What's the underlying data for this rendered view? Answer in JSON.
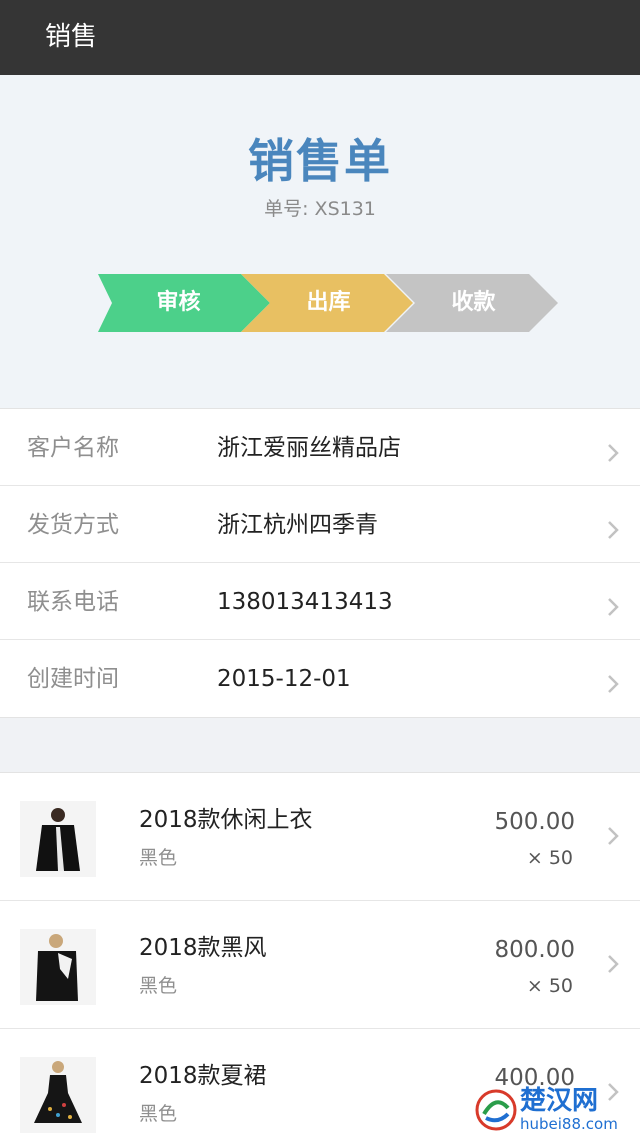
{
  "app": {
    "title": "销售"
  },
  "doc": {
    "title": "销售单",
    "number_label": "单号: ",
    "number_value": "XS131"
  },
  "steps": [
    {
      "label": "审核",
      "color": "#4cd08a"
    },
    {
      "label": "出库",
      "color": "#e8c062"
    },
    {
      "label": "收款",
      "color": "#c4c4c4"
    }
  ],
  "info": [
    {
      "key": "客户名称",
      "value": "浙江爱丽丝精品店"
    },
    {
      "key": "发货方式",
      "value": "浙江杭州四季青"
    },
    {
      "key": "联系电话",
      "value": "138013413413"
    },
    {
      "key": "创建时间",
      "value": "2015-12-01"
    }
  ],
  "products": [
    {
      "name": "2018款休闲上衣",
      "color": "黑色",
      "price": "500.00",
      "qty": "× 50"
    },
    {
      "name": "2018款黑风",
      "color": "黑色",
      "price": "800.00",
      "qty": "× 50"
    },
    {
      "name": "2018款夏裙",
      "color": "黑色",
      "price": "400.00",
      "qty": ""
    }
  ],
  "watermark": {
    "text": "楚汉网",
    "url": "hubei88.com"
  }
}
